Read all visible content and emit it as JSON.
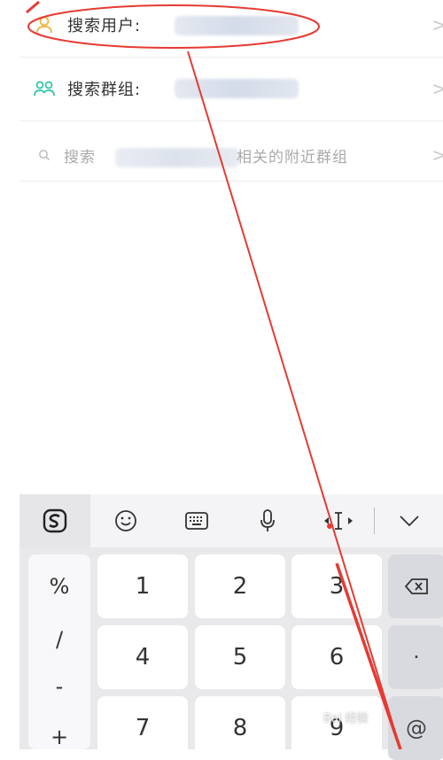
{
  "search_options": {
    "user": {
      "label": "搜索用户:"
    },
    "group": {
      "label": "搜索群组:"
    },
    "nearby": {
      "prefix": "搜索",
      "suffix": "相关的附近群组"
    }
  },
  "chevron": ">",
  "keyboard": {
    "toolbar_icons": [
      "sogou-logo-icon",
      "emoji-icon",
      "keyboard-icon",
      "microphone-icon",
      "cursor-move-icon",
      "chevron-down-icon"
    ],
    "symbols": [
      "%",
      "/",
      "-",
      "+"
    ],
    "keys": [
      "1",
      "2",
      "3",
      "4",
      "5",
      "6",
      "7",
      "8",
      "9"
    ],
    "dot_key": "·",
    "at_key": "@"
  },
  "watermark": "Bai 经验",
  "colors": {
    "annotation": "#e53b32",
    "user_icon": "#f2b33b",
    "group_icon": "#2cc5a6"
  }
}
